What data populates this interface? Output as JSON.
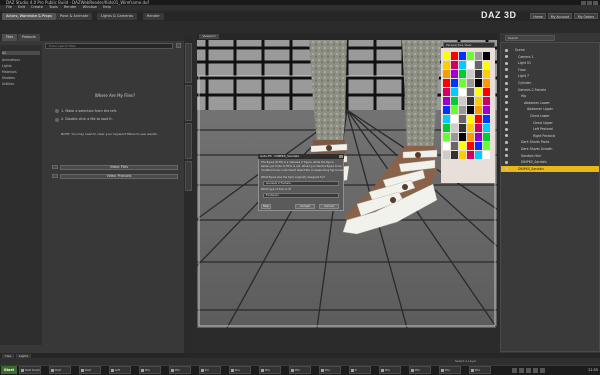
{
  "window": {
    "title": "DAZ Studio 4.0 Pro Public Build - DAZWebReader/Kids01_Wireframe.duf"
  },
  "menu": [
    "File",
    "Edit",
    "Create",
    "Tools",
    "Render",
    "Window",
    "Help"
  ],
  "rooms": {
    "tabs": [
      "Actors, Wardrobe & Props",
      "Pose & Animate",
      "Lights & Cameras",
      "Render"
    ],
    "active_index": 0
  },
  "header": {
    "logo": "DAZ 3D",
    "buttons": [
      "Home",
      "My Account",
      "My Orders"
    ]
  },
  "left_panel": {
    "tabs": [
      "Files",
      "Products"
    ],
    "search_placeholder": "Enter search filter",
    "categories": [
      "All",
      "Animations",
      "Lights",
      "Materials",
      "Shaders",
      "Utilities"
    ],
    "heading": "Where Are My Files?",
    "steps": [
      {
        "num": "1",
        "text": "Make a selection from the left."
      },
      {
        "num": "2",
        "text": "Double-click a file to load it."
      }
    ],
    "note": "NOTE: You may need to clear your keyword filters to see results.",
    "buttons": [
      "Video: Files",
      "Video: Products"
    ]
  },
  "viewport": {
    "camera_tab": "Viewport",
    "camera_select": "Perspective View"
  },
  "scene": {
    "search_placeholder": "Search",
    "items": [
      {
        "label": "Scene",
        "indent": 0
      },
      {
        "label": "Camera 1",
        "indent": 1
      },
      {
        "label": "Light 01",
        "indent": 1
      },
      {
        "label": "Floor",
        "indent": 1
      },
      {
        "label": "Light 7",
        "indent": 1
      },
      {
        "label": "Cylinder",
        "indent": 1
      },
      {
        "label": "Genesis 2 Female",
        "indent": 1
      },
      {
        "label": "Hip",
        "indent": 2
      },
      {
        "label": "Abdomen Lower",
        "indent": 3
      },
      {
        "label": "Abdomen Upper",
        "indent": 4
      },
      {
        "label": "Chest Lower",
        "indent": 5
      },
      {
        "label": "Chest Upper",
        "indent": 6
      },
      {
        "label": "Left Pectoral",
        "indent": 6
      },
      {
        "label": "Right Pectoral",
        "indent": 6
      },
      {
        "label": "Dark Shorts Pants",
        "indent": 2
      },
      {
        "label": "Dark Shorts Growth",
        "indent": 2
      },
      {
        "label": "Sandals Hair",
        "indent": 2
      },
      {
        "label": "DINPKS_Sandals",
        "indent": 2
      },
      {
        "label": "DINPKS_Sandals",
        "indent": 1
      }
    ],
    "selected_index": 18
  },
  "dialog": {
    "title": "Auto-Fit : DINPKS_Sandals",
    "line1": "The figure (D-Fit) is a 'Genesis 2' figure, while the figure",
    "line2": "below you'd like to fit to is not. Would you like the figure to be",
    "line3": "modified to be conformed? Select the corresponding figure below:",
    "q1": "What figure was the item originally designed for?",
    "sel1": "Genesis 2 Female",
    "q2": "What type of item is it?",
    "sel2": "Footwear",
    "buttons": [
      "Help",
      "Accept",
      "Cancel"
    ]
  },
  "bottom_tabs": [
    "Tips",
    "Lights"
  ],
  "status": "Select a Layer",
  "taskbar": {
    "start": "Start",
    "tasks": [
      "DAZ Studio",
      "DAZ",
      "DAZ",
      "Gift",
      "Pho",
      "Pho",
      "Ed",
      "Dro",
      "Pho",
      "Pho",
      "Pho",
      "P",
      "Pho",
      "Pho",
      "Pho",
      "Pho"
    ],
    "clock": "21:55"
  },
  "colors": {
    "selection": "#e7b818",
    "background": "#2b2b2b",
    "viewport_floor": "#6b6b6b"
  }
}
